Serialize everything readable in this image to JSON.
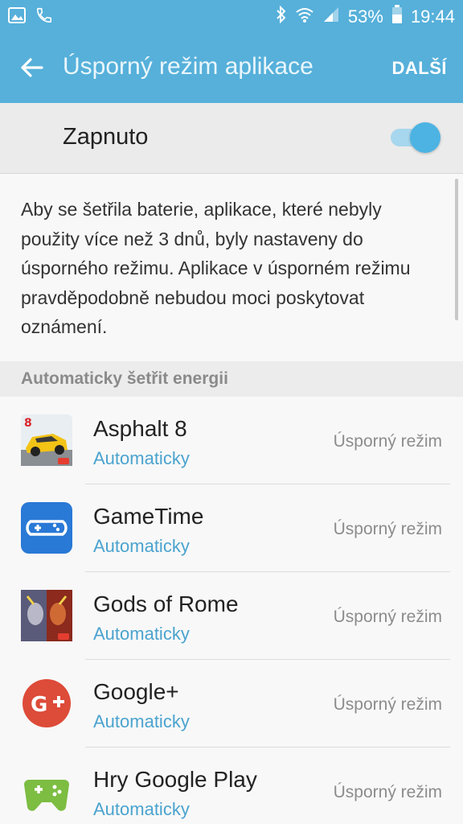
{
  "status_bar": {
    "battery_text": "53%",
    "time": "19:44",
    "icons": [
      "image-icon",
      "phone-icon",
      "bluetooth-icon",
      "wifi-icon",
      "signal-icon",
      "battery-icon"
    ]
  },
  "app_bar": {
    "title": "Úsporný režim aplikace",
    "next_label": "DALŠÍ"
  },
  "master_toggle": {
    "label": "Zapnuto",
    "state": "on"
  },
  "description": "Aby se šetřila baterie, aplikace, které nebyly použity více než 3 dnů, byly nastaveny do úsporného režimu. Aplikace v úsporném režimu pravděpodobně nebudou moci poskytovat oznámení.",
  "section": {
    "title": "Automaticky šetřit energii"
  },
  "apps": [
    {
      "name": "Asphalt 8",
      "status": "Automaticky",
      "mode": "Úsporný režim",
      "icon": "asphalt-8-icon"
    },
    {
      "name": "GameTime",
      "status": "Automaticky",
      "mode": "Úsporný režim",
      "icon": "gametime-icon"
    },
    {
      "name": "Gods of Rome",
      "status": "Automaticky",
      "mode": "Úsporný režim",
      "icon": "gods-of-rome-icon"
    },
    {
      "name": "Google+",
      "status": "Automaticky",
      "mode": "Úsporný režim",
      "icon": "google-plus-icon"
    },
    {
      "name": "Hry Google Play",
      "status": "Automaticky",
      "mode": "Úsporný režim",
      "icon": "google-play-games-icon"
    }
  ],
  "colors": {
    "accent": "#56b0da",
    "link": "#4aa3cf",
    "switch_on": "#4cb3e3"
  }
}
